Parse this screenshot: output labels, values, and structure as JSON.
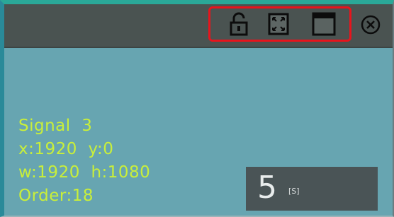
{
  "window": {
    "titlebar_icons": [
      "unlock-icon",
      "fullscreen-icon",
      "maximize-window-icon",
      "close-icon"
    ]
  },
  "info": {
    "signal": "Signal  3",
    "position": "x:1920  y:0",
    "size": "w:1920  h:1080",
    "order": "Order:18"
  },
  "counter": {
    "value": "5",
    "unit": "[S]"
  },
  "colors": {
    "titlebar": "#4a5351",
    "body": "#67a5b1",
    "text": "#c9ef3a",
    "highlight": "#e8141c",
    "counter_bg": "#4a5456"
  }
}
